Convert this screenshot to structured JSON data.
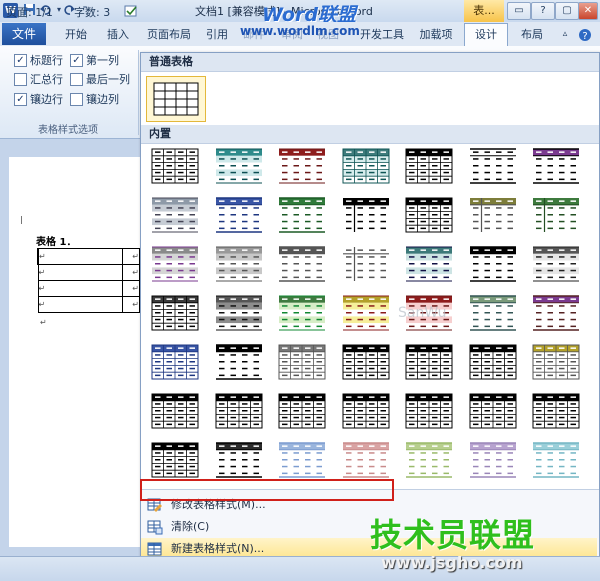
{
  "title_bar": {
    "app_icon_letter": "W",
    "doc_title": "文档1 [兼容模式] - Microsoft Word",
    "contextual_tab": "表...",
    "buttons": [
      "▭",
      "?",
      "▢",
      "✕"
    ]
  },
  "watermark": {
    "line1": "Word联盟",
    "line2": "www.wordlm.com",
    "mid": "SanWu",
    "brand": "技术员联盟",
    "brand_url": "www.jsgho.com"
  },
  "tabs": {
    "file": "文件",
    "items": [
      "开始",
      "插入",
      "页面布局",
      "引用",
      "邮件",
      "审阅",
      "视图",
      "开发工具",
      "加载项"
    ],
    "design": "设计",
    "layout": "布局"
  },
  "ribbon": {
    "options": [
      {
        "label": "标题行",
        "checked": true
      },
      {
        "label": "第一列",
        "checked": true
      },
      {
        "label": "汇总行",
        "checked": false
      },
      {
        "label": "最后一列",
        "checked": false
      },
      {
        "label": "镶边行",
        "checked": true
      },
      {
        "label": "镶边列",
        "checked": false
      }
    ],
    "group_label": "表格样式选项"
  },
  "document": {
    "caption": "表格 1．",
    "rows": 4,
    "mark": "↵"
  },
  "gallery": {
    "section_plain": "普通表格",
    "section_builtin": "内置",
    "menu": [
      {
        "label": "修改表格样式(M)...",
        "icon": "table-edit-icon"
      },
      {
        "label": "清除(C)",
        "icon": "table-clear-icon"
      },
      {
        "label": "新建表格样式(N)...",
        "icon": "table-new-icon"
      }
    ]
  },
  "status": {
    "page": "页面: 1/1",
    "words": "字数: 3"
  },
  "colors": {
    "file_tab": "#2a62b8",
    "contextual": "#f7c34a",
    "highlight": "#d0201a",
    "brand_green": "#2fbf1d"
  }
}
